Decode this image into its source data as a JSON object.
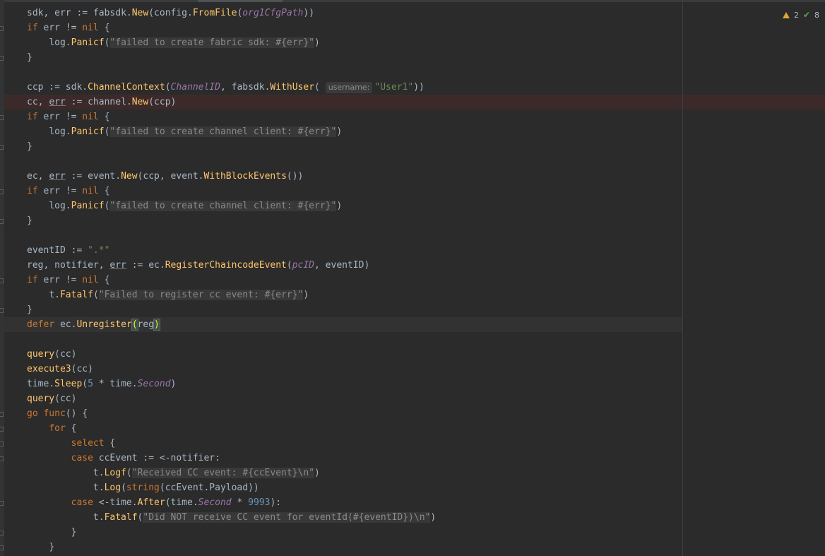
{
  "status": {
    "warnings": "2",
    "ok": "8"
  },
  "code": {
    "l1_sdk": "sdk",
    "l1_rest1": ", err := ",
    "l1_fabsdk": "fabsdk",
    "l1_new": "New",
    "l1_config": "config",
    "l1_fromfile": "FromFile",
    "l1_path": "org1CfgPath",
    "if_err": "if err != ",
    "nil": "nil",
    "open_brace": " {",
    "close_brace": "}",
    "log": "log",
    "panicf": "Panicf",
    "msg_sdk": "\"failed to create fabric sdk: #{err}\"",
    "ccp": "ccp := ",
    "sdk_dot": "sdk",
    "channelcontext": "ChannelContext",
    "channel_id": "ChannelID",
    "withuser": "WithUser",
    "hint_username": "username:",
    "user1": "\"User1\"",
    "cc_line_a": "cc, ",
    "err": "err",
    "cc_line_b": " := ",
    "channel": "channel",
    "new": "New",
    "ccp_arg": "ccp",
    "msg_channel": "\"failed to create channel client: #{err}\"",
    "ec_a": "ec, ",
    "event": "event",
    "withblockevents": "WithBlockEvents",
    "eventid_decl": "eventID := ",
    "eventid_val": "\".*\"",
    "reg_a": "reg, notifier, ",
    "ec": "ec",
    "registercc": "RegisterChaincodeEvent",
    "pcid": "pcID",
    "eventid_arg": ", eventID)",
    "t": "t",
    "fatalf": "Fatalf",
    "msg_register": "\"Failed to register cc event: #{err}\"",
    "defer": "defer",
    "unregister": "Unregister",
    "reg": "reg",
    "query": "query",
    "execute3": "execute3",
    "cc": "cc",
    "time": "time",
    "sleep": "Sleep",
    "five": "5",
    "second": "Second",
    "go": "go",
    "func": "func",
    "for": "for",
    "select": "select",
    "case": "case",
    "ccevent_recv": " ccEvent := <-notifier:",
    "logf": "Logf",
    "msg_received": "\"Received CC event: #{ccEvent}\\n\"",
    "logfn": "Log",
    "string": "string",
    "payload": "ccEvent.Payload",
    "after": "After",
    "num9993": "9993",
    "msg_notreceive": "\"Did NOT receive CC event for eventId(#{eventID})\\n\""
  }
}
